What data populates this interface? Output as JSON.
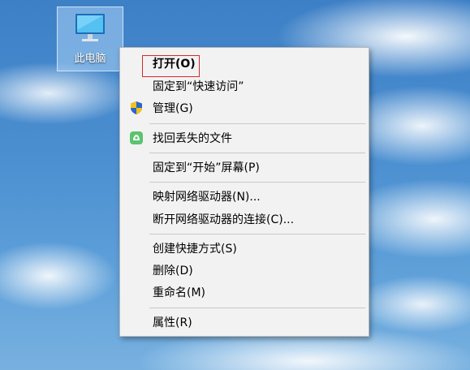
{
  "desktop": {
    "icon_label": "此电脑"
  },
  "context_menu": {
    "items": [
      {
        "label": "打开(O)",
        "bold": true
      },
      {
        "label": "固定到“快速访问”"
      },
      {
        "label": "管理(G)",
        "icon": "shield-icon"
      },
      {
        "label": "找回丢失的文件",
        "icon": "recovery-icon"
      },
      {
        "label": "固定到“开始”屏幕(P)"
      },
      {
        "label": "映射网络驱动器(N)..."
      },
      {
        "label": "断开网络驱动器的连接(C)..."
      },
      {
        "label": "创建快捷方式(S)"
      },
      {
        "label": "删除(D)"
      },
      {
        "label": "重命名(M)"
      },
      {
        "label": "属性(R)"
      }
    ]
  },
  "colors": {
    "highlight_border": "#d22a2a",
    "menu_bg": "#f2f2f2"
  }
}
